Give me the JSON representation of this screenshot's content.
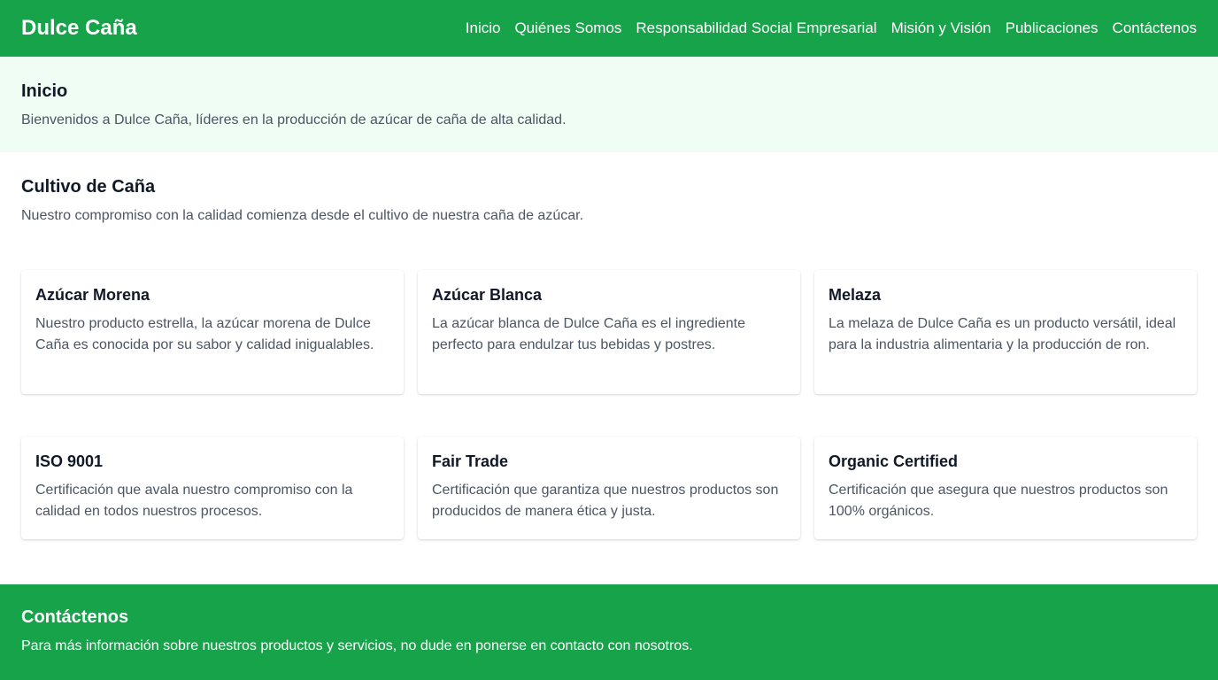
{
  "header": {
    "brand": "Dulce Caña",
    "nav": [
      "Inicio",
      "Quiénes Somos",
      "Responsabilidad Social Empresarial",
      "Misión y Visión",
      "Publicaciones",
      "Contáctenos"
    ]
  },
  "hero": {
    "title": "Inicio",
    "text": "Bienvenidos a Dulce Caña, líderes en la producción de azúcar de caña de alta calidad."
  },
  "cultivo": {
    "title": "Cultivo de Caña",
    "text": "Nuestro compromiso con la calidad comienza desde el cultivo de nuestra caña de azúcar."
  },
  "products": [
    {
      "title": "Azúcar Morena",
      "text": "Nuestro producto estrella, la azúcar morena de Dulce Caña es conocida por su sabor y calidad inigualables."
    },
    {
      "title": "Azúcar Blanca",
      "text": "La azúcar blanca de Dulce Caña es el ingrediente perfecto para endulzar tus bebidas y postres."
    },
    {
      "title": "Melaza",
      "text": "La melaza de Dulce Caña es un producto versátil, ideal para la industria alimentaria y la producción de ron."
    }
  ],
  "certifications": [
    {
      "title": "ISO 9001",
      "text": "Certificación que avala nuestro compromiso con la calidad en todos nuestros procesos."
    },
    {
      "title": "Fair Trade",
      "text": "Certificación que garantiza que nuestros productos son producidos de manera ética y justa."
    },
    {
      "title": "Organic Certified",
      "text": "Certificación que asegura que nuestros productos son 100% orgánicos."
    }
  ],
  "footer": {
    "title": "Contáctenos",
    "text": "Para más información sobre nuestros productos y servicios, no dude en ponerse en contacto con nosotros."
  },
  "colors": {
    "primary": "#16a34a",
    "hero_bg": "#f0fdf4"
  }
}
